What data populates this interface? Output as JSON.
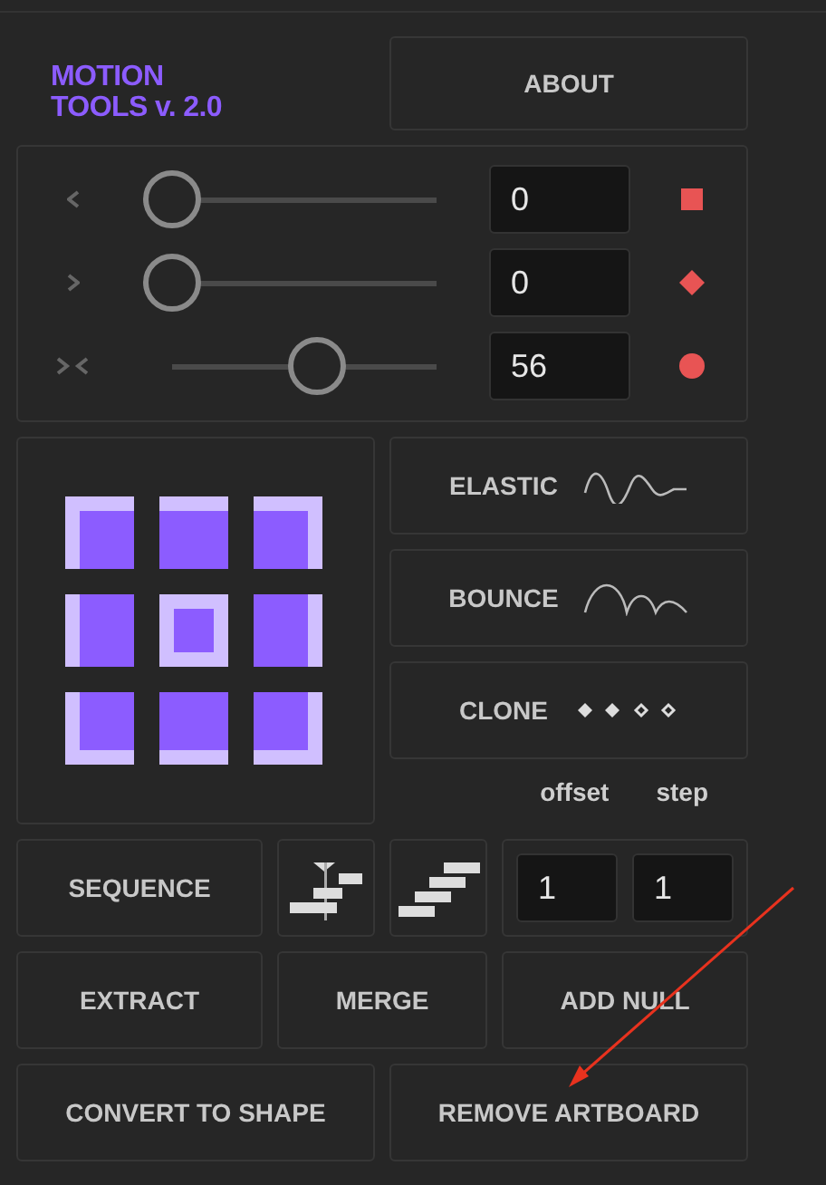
{
  "title_lines": [
    "MOTION",
    "TOOLS v. 2.0"
  ],
  "about_button": "ABOUT",
  "sliders": [
    {
      "kind": "left",
      "level": 0,
      "value": "0",
      "keyframe": {
        "kind": "square"
      }
    },
    {
      "kind": "right",
      "level": 0,
      "value": "0",
      "keyframe": {
        "kind": "diamond"
      }
    },
    {
      "kind": "both",
      "level": 0.56,
      "value": "56",
      "keyframe": {
        "kind": "circle"
      }
    }
  ],
  "anchors": [
    {
      "selected": false
    },
    {
      "selected": false
    },
    {
      "selected": false
    },
    {
      "selected": false
    },
    {
      "selected": true
    },
    {
      "selected": false
    },
    {
      "selected": false
    },
    {
      "selected": false
    },
    {
      "selected": false
    }
  ],
  "easing_buttons": [
    {
      "label": "ELASTIC",
      "kind": "elastic"
    },
    {
      "label": "BOUNCE",
      "kind": "bounce"
    },
    {
      "label": "CLONE",
      "kind": "clone"
    }
  ],
  "clone_labels": [
    "offset",
    "step"
  ],
  "sequence_button": "SEQUENCE",
  "clone_values": [
    "1",
    "1"
  ],
  "bottom_buttons": [
    {
      "label": "EXTRACT",
      "kind": "one"
    },
    {
      "label": "MERGE",
      "kind": "two"
    },
    {
      "label": "ADD NULL",
      "kind": "one"
    },
    {
      "label": "CONVERT TO SHAPE",
      "kind": "two"
    },
    {
      "label": "REMOVE ARTBOARD",
      "kind": "two"
    }
  ]
}
